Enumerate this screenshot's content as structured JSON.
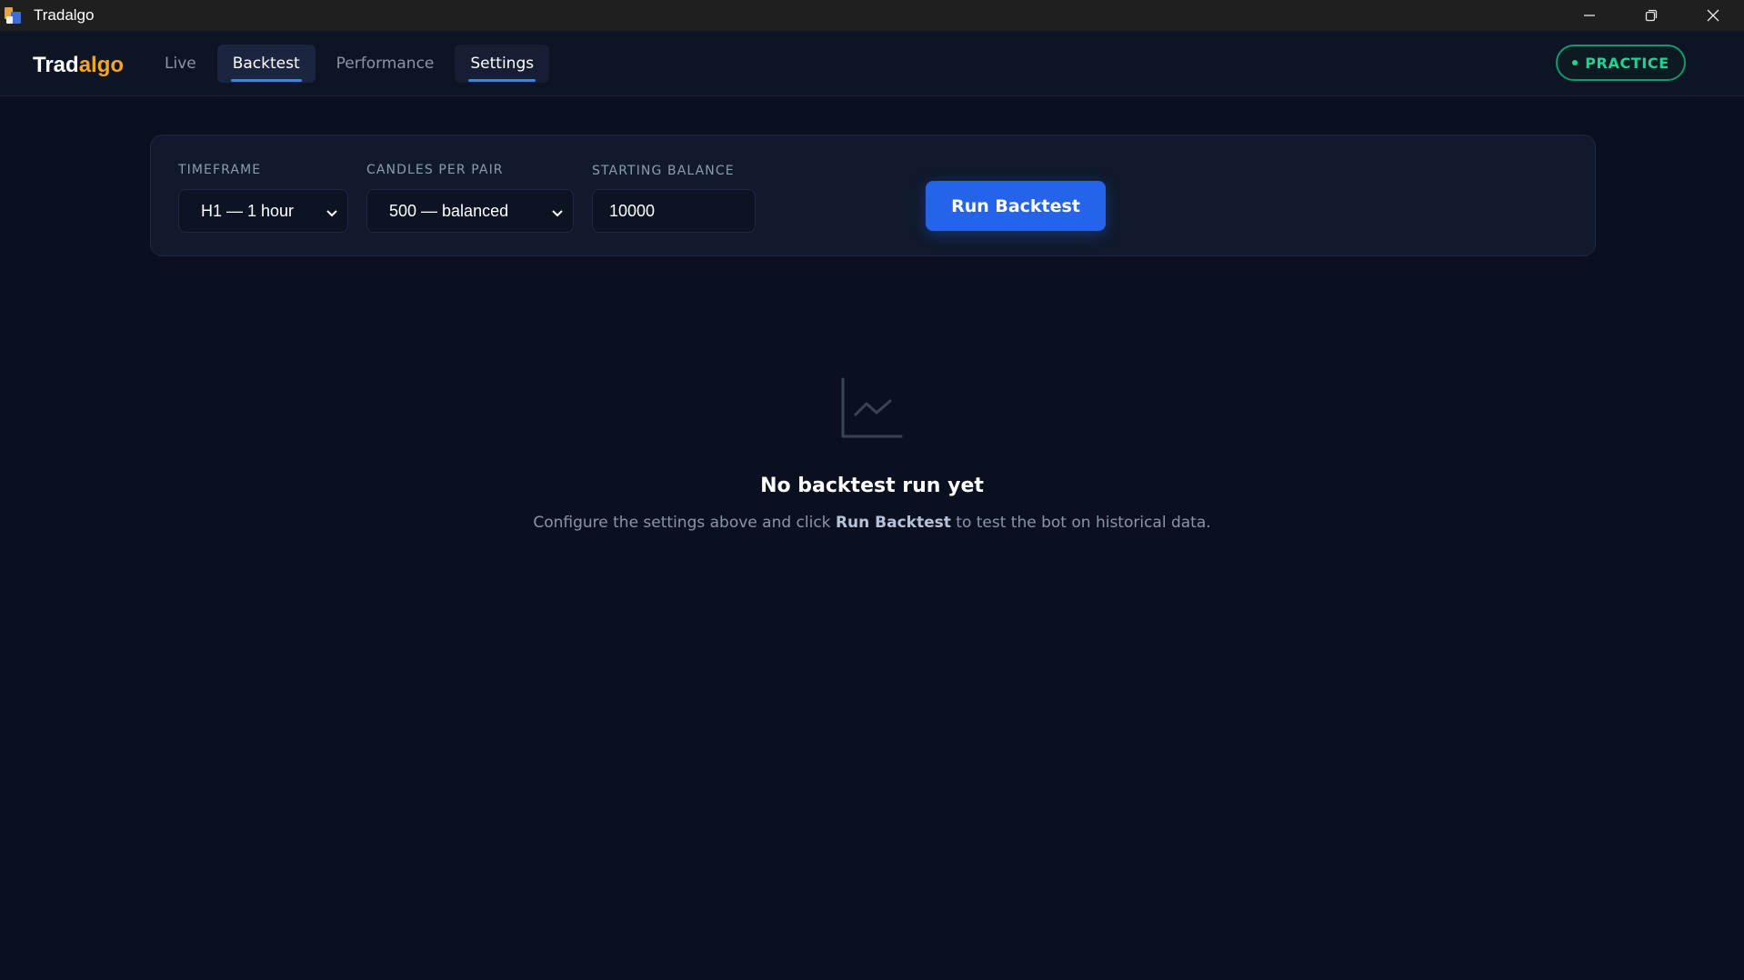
{
  "window": {
    "title": "Tradalgo",
    "controls": [
      "minimize-icon",
      "restore-icon",
      "close-icon"
    ]
  },
  "header": {
    "brand_part1": "Trad",
    "brand_part2": "algo",
    "tabs": [
      {
        "label": "Live",
        "state": "normal"
      },
      {
        "label": "Backtest",
        "state": "active"
      },
      {
        "label": "Performance",
        "state": "normal"
      },
      {
        "label": "Settings",
        "state": "hover"
      }
    ],
    "mode_badge": "PRACTICE"
  },
  "config": {
    "timeframe": {
      "label": "TIMEFRAME",
      "value": "H1 — 1 hour"
    },
    "candles": {
      "label": "CANDLES PER PAIR",
      "value": "500 — balanced"
    },
    "balance": {
      "label": "STARTING BALANCE",
      "value": "10000"
    },
    "run_label": "Run Backtest"
  },
  "empty_state": {
    "icon": "line-chart-icon",
    "title": "No backtest run yet",
    "desc_before": "Configure the settings above and click ",
    "desc_bold": "Run Backtest",
    "desc_after": " to test the bot on historical data."
  },
  "colors": {
    "background": "#0b1020",
    "accent": "#2563eb",
    "brand_orange": "#f5a524",
    "practice_green": "#1ed494"
  }
}
